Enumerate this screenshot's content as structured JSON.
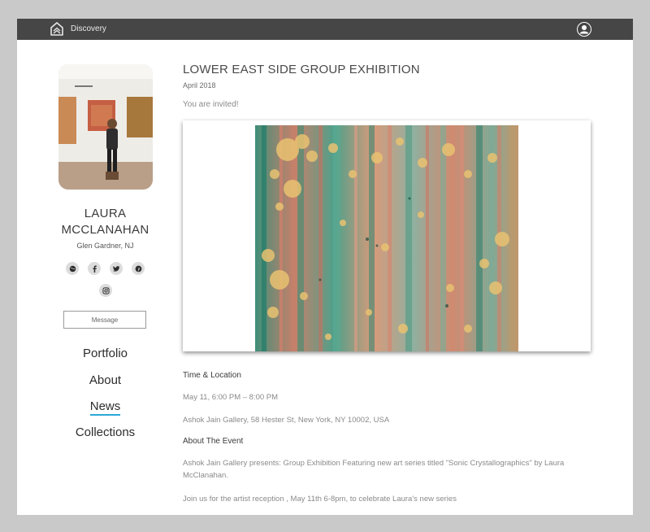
{
  "header": {
    "brand": "Discovery",
    "logo_icon": "discovery-logo-icon",
    "user_icon": "user-account-icon",
    "background": "#464646"
  },
  "profile": {
    "name_line1": "LAURA",
    "name_line2": "MCCLANAHAN",
    "location": "Glen Gardner, NJ",
    "social_icons": [
      "globe-icon",
      "facebook-icon",
      "twitter-icon",
      "pinterest-icon",
      "instagram-icon"
    ],
    "message_label": "Message"
  },
  "nav": {
    "items": [
      {
        "label": "Portfolio"
      },
      {
        "label": "About"
      },
      {
        "label": "News"
      },
      {
        "label": "Collections"
      }
    ],
    "active_index": 2,
    "active_underline": "#2aa8d8"
  },
  "article": {
    "title": "LOWER EAST SIDE GROUP EXHIBITION",
    "date": "April 2018",
    "intro": "You are invited!",
    "time_location_heading": "Time & Location",
    "time": "May 11, 6:00 PM – 8:00 PM",
    "address": "Ashok Jain Gallery, 58 Hester St, New York, NY 10002, USA",
    "about_heading": "About The Event",
    "about_line1": "Ashok Jain Gallery presents: Group Exhibition Featuring new art series titled \"Sonic Crystallographics\" by Laura",
    "about_line2": "McClanahan.",
    "reception": "Join us for the artist reception , May 11th 6-8pm, to celebrate Laura's new series"
  }
}
